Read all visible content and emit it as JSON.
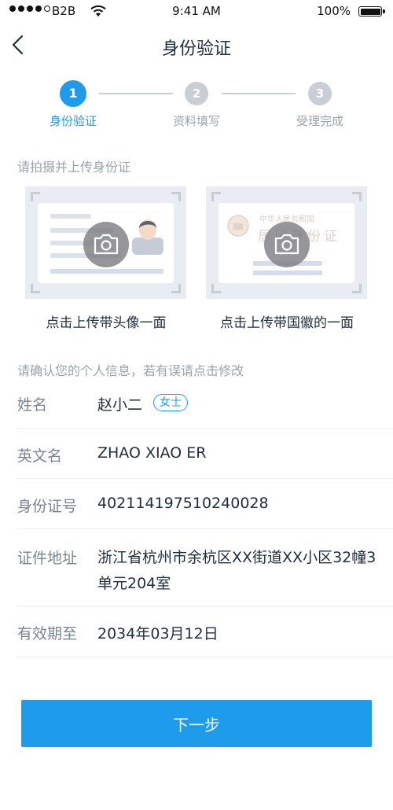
{
  "status_bar": {
    "carrier": "B2B",
    "time": "9:41 AM",
    "battery": "100%",
    "icons": [
      "signal-icon",
      "wifi-icon",
      "battery-icon"
    ]
  },
  "nav": {
    "title": "身份验证",
    "back_icon": "chevron-left-icon"
  },
  "steps": [
    {
      "number": "1",
      "label": "身份验证",
      "state": "active"
    },
    {
      "number": "2",
      "label": "资料填写",
      "state": "inactive"
    },
    {
      "number": "3",
      "label": "受理完成",
      "state": "inactive"
    }
  ],
  "upload": {
    "hint": "请拍摄并上传身份证",
    "front_caption": "点击上传带头像一面",
    "back_caption": "点击上传带国徽的一面",
    "emblem_text_line1": "中华人民共和国",
    "emblem_text_line2": "居民身份证",
    "camera_icon": "camera-icon"
  },
  "info": {
    "hint": "请确认您的个人信息，若有误请点击修改",
    "rows": [
      {
        "label": "姓名",
        "value": "赵小二",
        "tag": "女士"
      },
      {
        "label": "英文名",
        "value": "ZHAO XIAO ER"
      },
      {
        "label": "身份证号",
        "value": "402114197510240028"
      },
      {
        "label": "证件地址",
        "value": "浙江省杭州市余杭区XX街道XX小区32幢3单元204室"
      },
      {
        "label": "有效期至",
        "value": "2034年03月12日"
      }
    ]
  },
  "next_button": "下一步",
  "colors": {
    "accent": "#1e9bea",
    "inactive_step": "#c9ced6",
    "hint_text": "#9aa3ad"
  }
}
